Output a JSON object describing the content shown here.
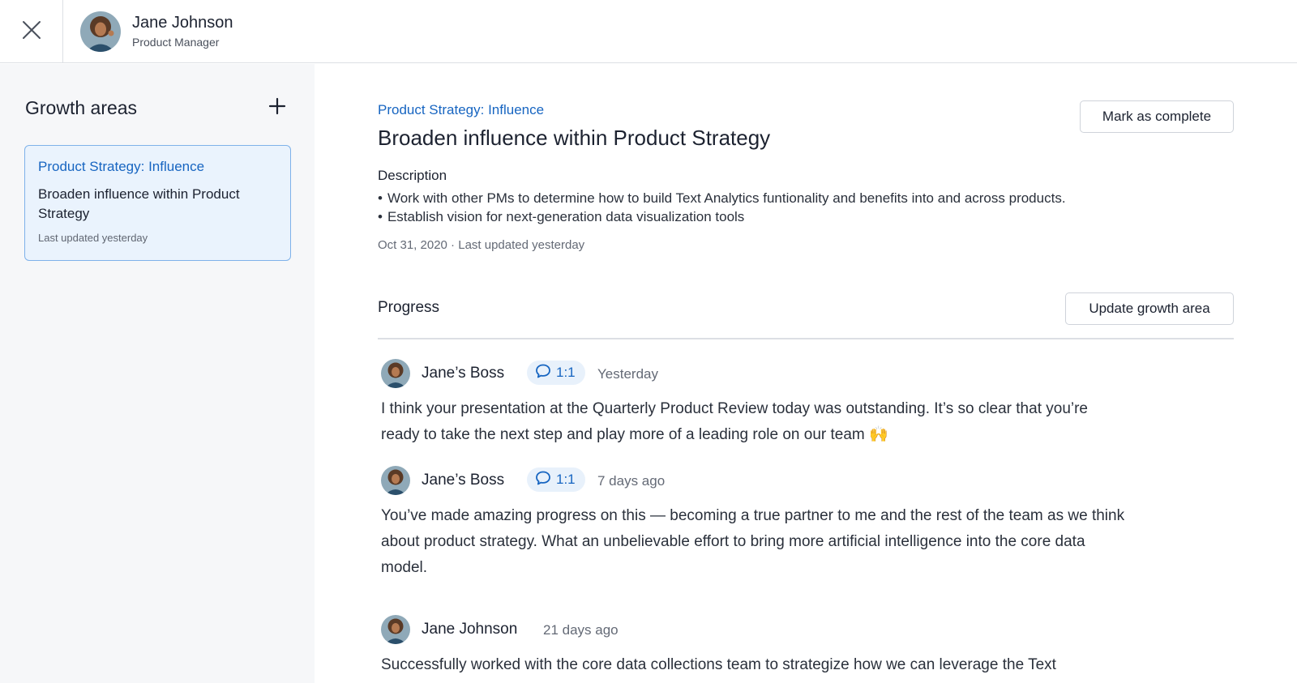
{
  "header": {
    "close_icon": "close-icon",
    "user": {
      "name": "Jane Johnson",
      "role": "Product Manager"
    }
  },
  "sidebar": {
    "title": "Growth areas",
    "add_icon": "plus-icon",
    "items": [
      {
        "category": "Product Strategy: Influence",
        "title": "Broaden influence within Product Strategy",
        "updated": "Last updated yesterday"
      }
    ]
  },
  "main": {
    "category": "Product Strategy: Influence",
    "title": "Broaden influence within Product Strategy",
    "mark_complete_label": "Mark as complete",
    "description_label": "Description",
    "description_items": [
      "Work with other PMs to determine how to build Text Analytics funtionality and benefits into and across products.",
      "Establish vision for next-generation data visualization tools"
    ],
    "meta": "Oct 31, 2020 · Last updated yesterday",
    "progress_label": "Progress",
    "update_label": "Update growth area",
    "entries": [
      {
        "author": "Jane’s Boss",
        "badge": "1:1",
        "time": "Yesterday",
        "text": "I think your presentation at the Quarterly Product Review today was outstanding. It’s so clear that you’re ready to take the next step and play more of a leading role on our team 🙌"
      },
      {
        "author": "Jane’s Boss",
        "badge": "1:1",
        "time": "7 days ago",
        "text": "You’ve made amazing progress on this — becoming a true partner to me and the rest of the team as we think about product strategy. What an unbelievable effort to bring more artificial intelligence into the core data model."
      },
      {
        "author": "Jane Johnson",
        "badge": "",
        "time": "21 days ago",
        "text": "Successfully worked with the core data collections team to strategize how we can leverage the Text"
      }
    ]
  },
  "colors": {
    "accent": "#1765c1",
    "selected_card_bg": "#eaf3fd",
    "sidebar_bg": "#f6f7f9"
  }
}
